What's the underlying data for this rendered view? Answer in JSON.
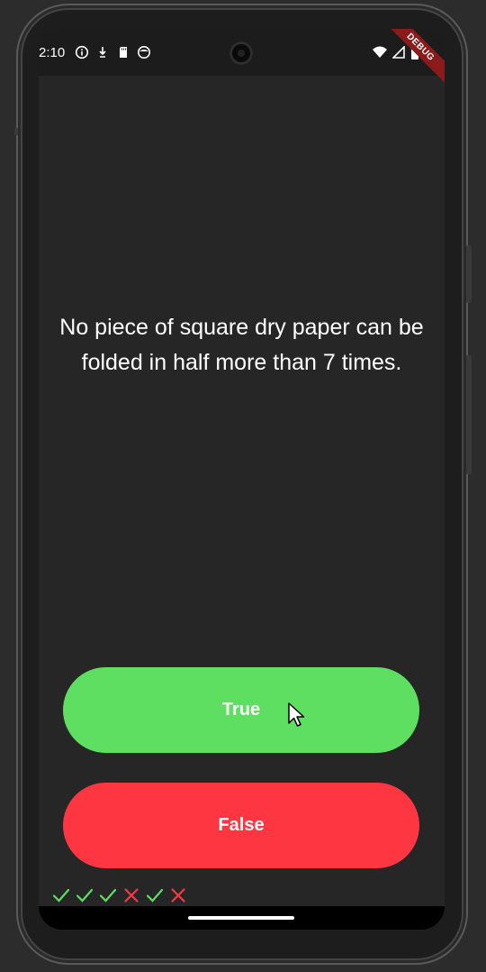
{
  "status_bar": {
    "time": "2:10",
    "left_icons": [
      "info-icon",
      "download-arrow-icon",
      "sd-card-icon",
      "face-icon"
    ],
    "right_icons": [
      "wifi-icon",
      "signal-icon",
      "battery-icon"
    ],
    "debug_banner": "DEBUG"
  },
  "quiz": {
    "question": "No piece of square dry paper can be folded in half more than 7 times.",
    "true_label": "True",
    "false_label": "False"
  },
  "score": [
    {
      "result": "correct",
      "icon": "check-icon",
      "color": "#5edf62"
    },
    {
      "result": "correct",
      "icon": "check-icon",
      "color": "#5edf62"
    },
    {
      "result": "correct",
      "icon": "check-icon",
      "color": "#5edf62"
    },
    {
      "result": "wrong",
      "icon": "close-icon",
      "color": "#fd3641"
    },
    {
      "result": "correct",
      "icon": "check-icon",
      "color": "#5edf62"
    },
    {
      "result": "wrong",
      "icon": "close-icon",
      "color": "#fd3641"
    }
  ],
  "colors": {
    "true_button": "#5edf62",
    "false_button": "#fd3641",
    "background": "#262626"
  }
}
